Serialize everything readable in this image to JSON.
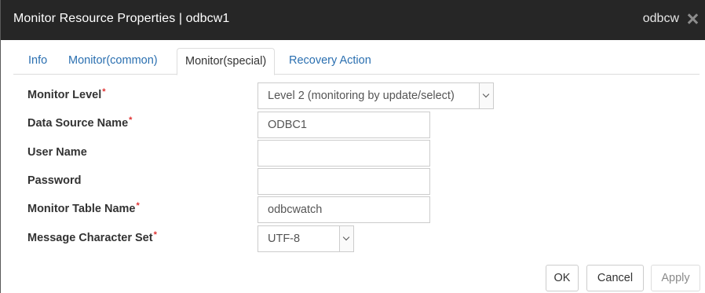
{
  "window": {
    "title": "Monitor Resource Properties | odbcw1",
    "resource_type": "odbcw",
    "close_icon": "close-icon"
  },
  "tabs": [
    {
      "label": "Info",
      "active": false
    },
    {
      "label": "Monitor(common)",
      "active": false
    },
    {
      "label": "Monitor(special)",
      "active": true
    },
    {
      "label": "Recovery Action",
      "active": false
    }
  ],
  "form": {
    "required_mark": "*",
    "monitor_level": {
      "label": "Monitor Level",
      "value": "Level 2 (monitoring by update/select)",
      "required": true
    },
    "data_source_name": {
      "label": "Data Source Name",
      "value": "ODBC1",
      "required": true
    },
    "user_name": {
      "label": "User Name",
      "value": "",
      "required": false
    },
    "password": {
      "label": "Password",
      "value": "",
      "required": false
    },
    "monitor_table_name": {
      "label": "Monitor Table Name",
      "value": "odbcwatch",
      "required": true
    },
    "message_character_set": {
      "label": "Message Character Set",
      "value": "UTF-8",
      "required": true
    }
  },
  "buttons": {
    "ok": "OK",
    "cancel": "Cancel",
    "apply": "Apply"
  },
  "colors": {
    "titlebar": "#262626",
    "tab_link": "#2a6fb0",
    "required": "#e03030"
  }
}
